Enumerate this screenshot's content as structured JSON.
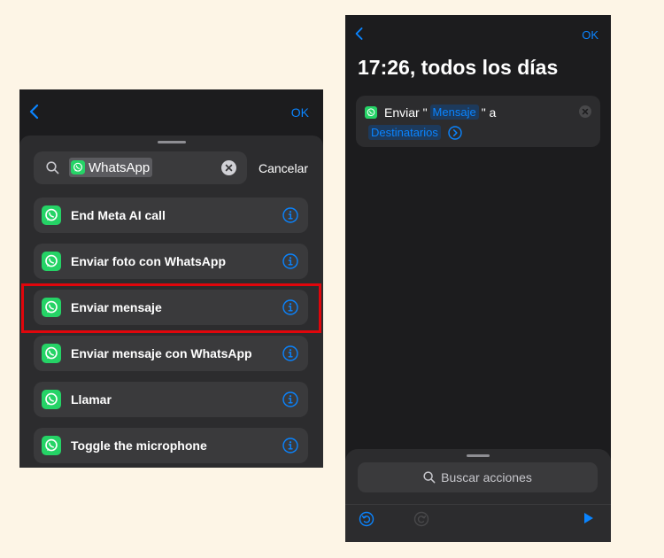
{
  "left_screen": {
    "nav": {
      "ok_label": "OK"
    },
    "search": {
      "token_text": "WhatsApp",
      "cancel_label": "Cancelar"
    },
    "results": [
      {
        "label": "End Meta AI call"
      },
      {
        "label": "Enviar foto con WhatsApp"
      },
      {
        "label": "Enviar mensaje"
      },
      {
        "label": "Enviar mensaje con WhatsApp"
      },
      {
        "label": "Llamar"
      },
      {
        "label": "Toggle the microphone"
      }
    ]
  },
  "right_screen": {
    "nav": {
      "ok_label": "OK"
    },
    "title": "17:26, todos los días",
    "action": {
      "prefix": "Enviar \"",
      "message_chip": "Mensaje",
      "middle": "\" a",
      "recipients_chip": "Destinatarios"
    },
    "search_actions_label": "Buscar acciones"
  },
  "colors": {
    "accent": "#0a84ff",
    "whatsapp_green": "#25d366",
    "highlight_red": "#e0060c",
    "page_background": "#fdf5e6"
  }
}
